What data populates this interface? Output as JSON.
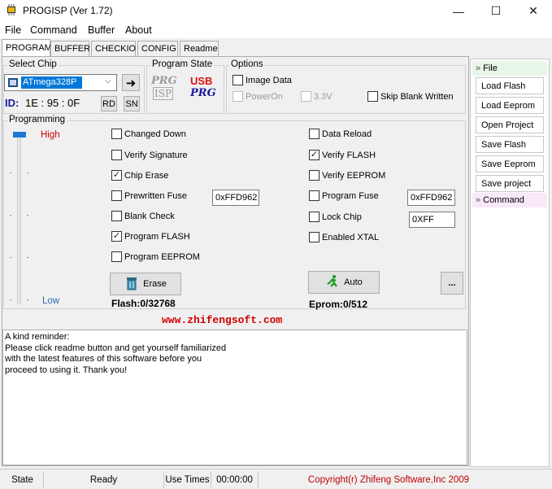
{
  "window": {
    "title": "PROGISP (Ver 1.72)",
    "controls": {
      "minimize": "—",
      "maximize": "☐",
      "close": "✕"
    }
  },
  "menu": [
    "File",
    "Command",
    "Buffer",
    "About"
  ],
  "tabs": [
    {
      "label": "PROGRAM",
      "active": true
    },
    {
      "label": "BUFFER"
    },
    {
      "label": "CHECKIO"
    },
    {
      "label": "CONFIG"
    },
    {
      "label": "Readme"
    }
  ],
  "select_chip": {
    "title": "Select Chip",
    "chip": "ATmega328P",
    "id_label": "ID:",
    "id_value": "1E : 95 : 0F",
    "rd_label": "RD",
    "sn_label": "SN"
  },
  "program_state": {
    "title": "Program State",
    "prg_top": "PRG",
    "isp_label": "ISP",
    "usb_label": "USB",
    "prg_bottom": "PRG"
  },
  "options": {
    "title": "Options",
    "image_data": {
      "label": "Image Data",
      "checked": false
    },
    "power_on": {
      "label": "PowerOn",
      "checked": false,
      "disabled": true
    },
    "v33": {
      "label": "3.3V",
      "checked": false,
      "disabled": true
    },
    "skip_blank": {
      "label": "Skip Blank Written",
      "checked": false
    }
  },
  "programming": {
    "title": "Programming",
    "slider_high": "High",
    "slider_low": "Low",
    "left_options": [
      {
        "label": "Changed Down",
        "checked": false
      },
      {
        "label": "Verify Signature",
        "checked": false
      },
      {
        "label": "Chip Erase",
        "checked": true
      },
      {
        "label": "Prewritten Fuse",
        "checked": false
      },
      {
        "label": "Blank Check",
        "checked": false
      },
      {
        "label": "Program FLASH",
        "checked": true
      },
      {
        "label": "Program EEPROM",
        "checked": false
      }
    ],
    "right_options": [
      {
        "label": "Data Reload",
        "checked": false
      },
      {
        "label": "Verify FLASH",
        "checked": true
      },
      {
        "label": "Verify EEPROM",
        "checked": false
      },
      {
        "label": "Program Fuse",
        "checked": false
      },
      {
        "label": "Lock Chip",
        "checked": false
      },
      {
        "label": "Enabled XTAL",
        "checked": false
      }
    ],
    "prewritten_fuse_value": "0xFFD962",
    "program_fuse_value": "0xFFD962",
    "lock_chip_value": "0XFF",
    "erase_label": "Erase",
    "auto_label": "Auto",
    "more_label": "...",
    "flash_status": "Flash:0/32768",
    "eprom_status": "Eprom:0/512"
  },
  "website": "www.zhifengsoft.com",
  "log_lines": [
    "A kind reminder:",
    "Please click readme button and get yourself familiarized",
    "with the latest features of this software before you",
    "proceed to using it. Thank you!"
  ],
  "side_panel": {
    "file_header": "File",
    "file_buttons": [
      "Load Flash",
      "Load Eeprom",
      "Open Project",
      "Save Flash",
      "Save Eeprom",
      "Save project"
    ],
    "command_header": "Command"
  },
  "status": {
    "state_label": "State",
    "state_value": "Ready",
    "use_times_label": "Use Times",
    "use_times_value": "00:00:00",
    "copyright": "Copyright(r) Zhifeng Software,Inc 2009"
  },
  "colors": {
    "high_label": "#d00000",
    "low_label": "#2b6cb0",
    "website": "#d00000",
    "copyright": "#c00000",
    "chip_select_bg": "#0078d7",
    "slider_thumb": "#1e78d7",
    "file_header_bg": "#e8f6e8",
    "command_header_bg": "#f8e8f8"
  }
}
